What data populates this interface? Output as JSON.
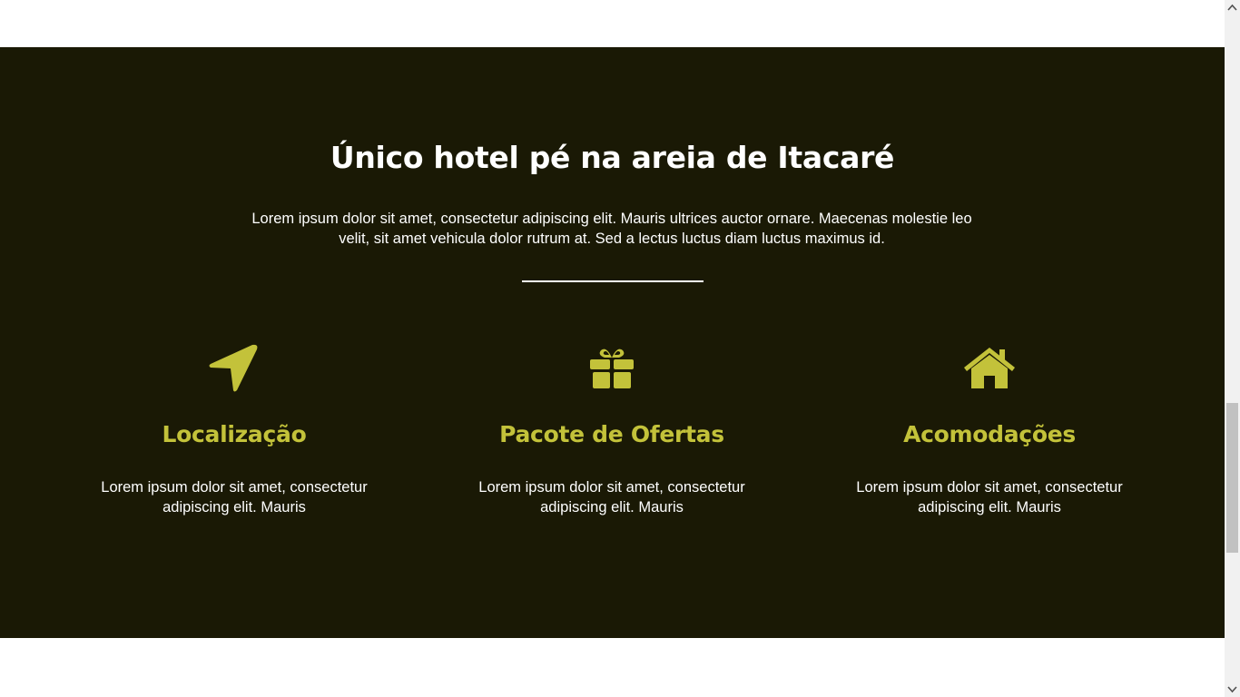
{
  "section": {
    "title": "Único hotel pé na areia de Itacaré",
    "intro": "Lorem ipsum dolor sit amet, consectetur adipiscing elit. Mauris ultrices auctor ornare. Maecenas molestie leo velit, sit amet vehicula dolor rutrum at. Sed a lectus luctus diam luctus maximus id.",
    "colors": {
      "background": "#1a1905",
      "accent": "#c3c23a",
      "text": "#ffffff"
    }
  },
  "features": [
    {
      "icon": "location-arrow-icon",
      "title": "Localização",
      "description": "Lorem ipsum dolor sit amet, consectetur adipiscing elit. Mauris"
    },
    {
      "icon": "gift-icon",
      "title": "Pacote de Ofertas",
      "description": "Lorem ipsum dolor sit amet, consectetur adipiscing elit. Mauris"
    },
    {
      "icon": "home-icon",
      "title": "Acomodações",
      "description": "Lorem ipsum dolor sit amet, consectetur adipiscing elit. Mauris"
    }
  ]
}
